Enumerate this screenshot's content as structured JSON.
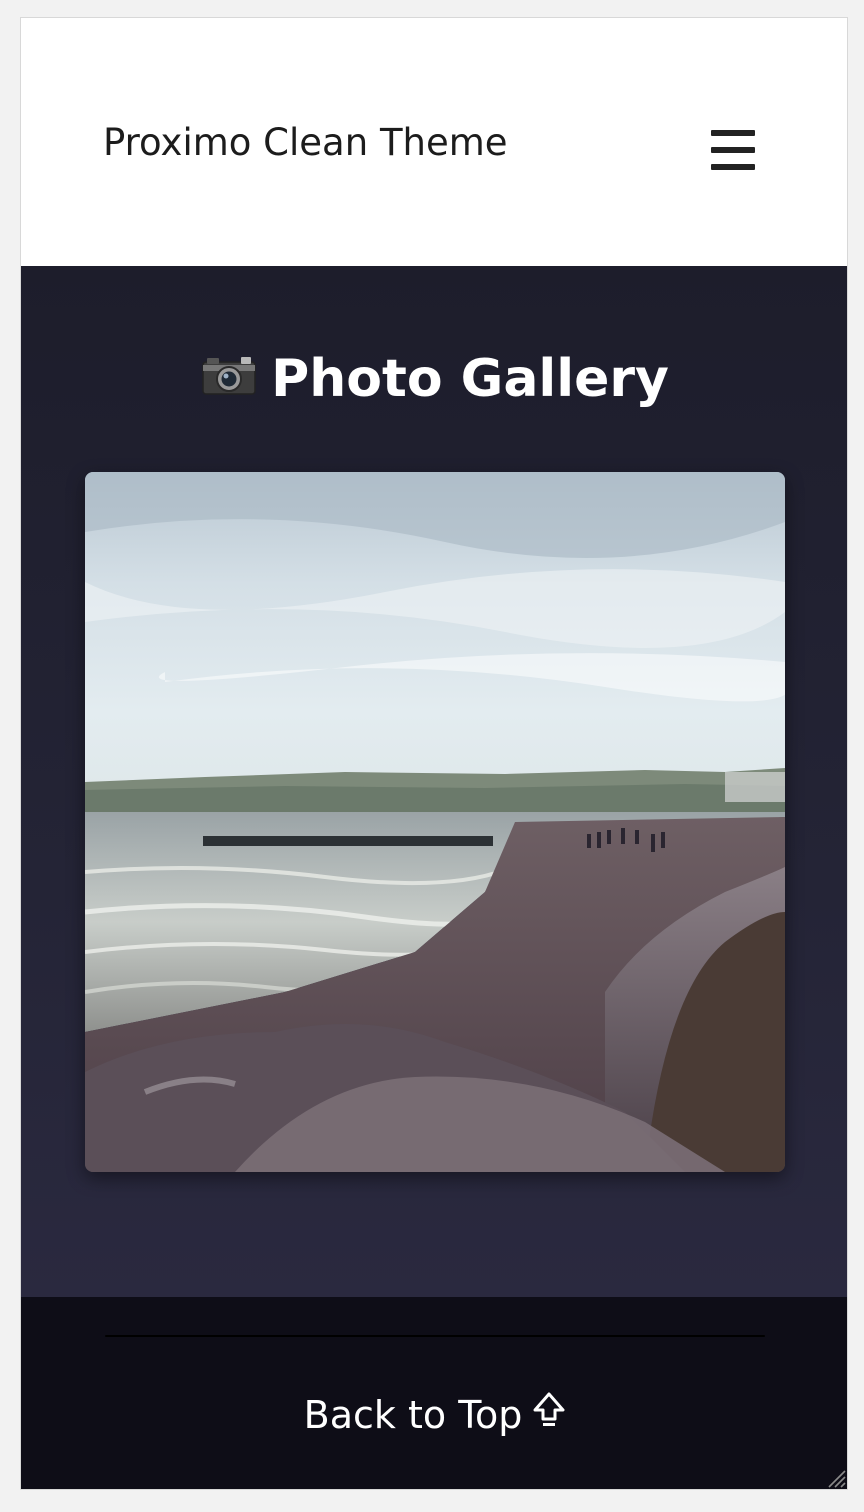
{
  "header": {
    "site_title": "Proximo Clean Theme",
    "menu_icon": "hamburger-menu-icon"
  },
  "gallery": {
    "title": "Photo Gallery",
    "title_icon": "camera-icon",
    "photos": [
      {
        "subject": "rocky beach shoreline with sea and overcast sky"
      }
    ]
  },
  "footer": {
    "back_to_top_label": "Back to Top",
    "back_to_top_icon": "up-arrow-icon"
  },
  "colors": {
    "header_bg": "#ffffff",
    "gallery_bg": "#1d1d2b",
    "footer_bg": "#0e0d17",
    "title_text": "#1c1c1c",
    "light_text": "#ffffff"
  }
}
